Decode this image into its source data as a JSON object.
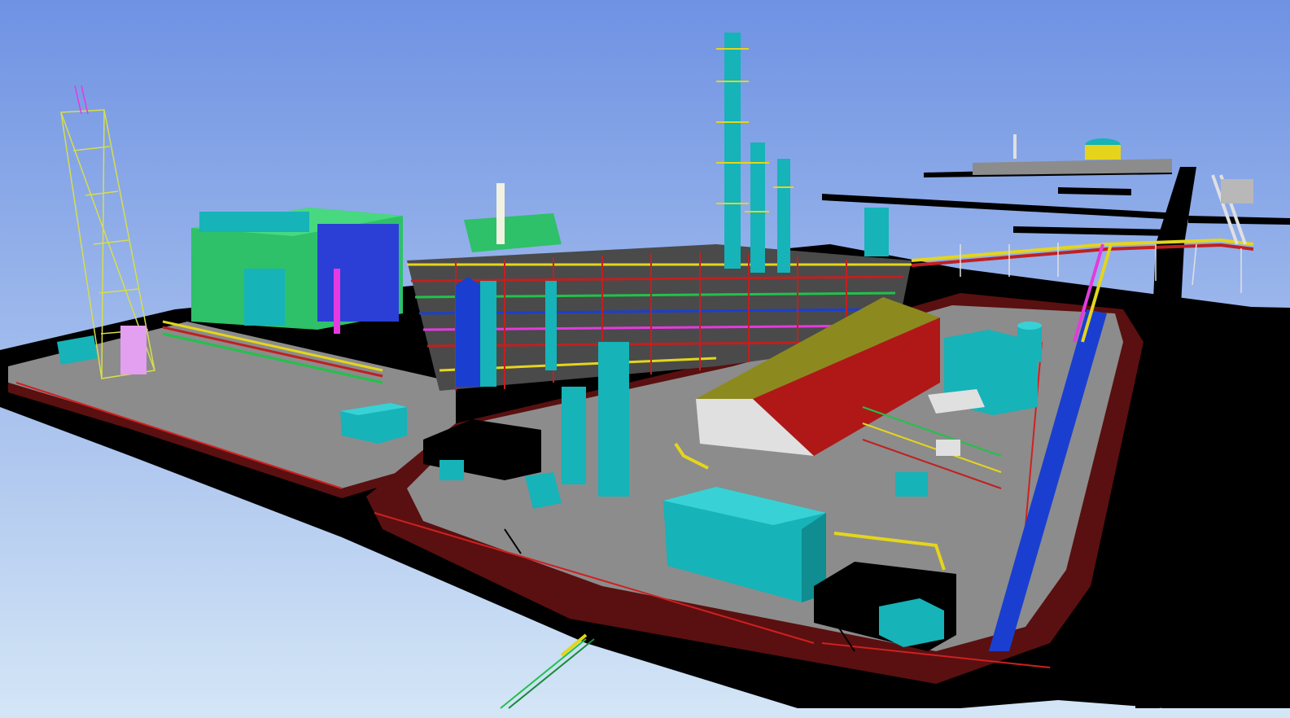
{
  "scene": {
    "kind": "3D plant design model render (isometric view of a refinery / process plant)",
    "colors": {
      "sky_top": "#6f92e3",
      "sky_bottom": "#d4e6f6",
      "road": "#000000",
      "ground": "#8c8c8c",
      "curb": "#5a1010",
      "equipment": "#16b3b8",
      "building_green": "#2fc06a",
      "roof": "#8c8a1e",
      "pipe_red": "#c02020",
      "pipe_yellow": "#e4d51c",
      "pipe_green": "#21c24a",
      "pipe_blue": "#1a3fd0",
      "pipe_magenta": "#e43adf",
      "steel_white": "#e0e0e0"
    },
    "objects": [
      {
        "name": "flare-stack-lattice-tower",
        "icon": "lattice-tower"
      },
      {
        "name": "boiler-house",
        "icon": "building"
      },
      {
        "name": "distillation-columns",
        "icon": "column"
      },
      {
        "name": "central-pipe-rack",
        "icon": "pipe-rack"
      },
      {
        "name": "warehouse-shed",
        "icon": "shed"
      },
      {
        "name": "storage-tank-area",
        "icon": "tank"
      },
      {
        "name": "pipe-bridge",
        "icon": "pipe-bridge"
      },
      {
        "name": "access-roads",
        "icon": "road"
      }
    ]
  }
}
